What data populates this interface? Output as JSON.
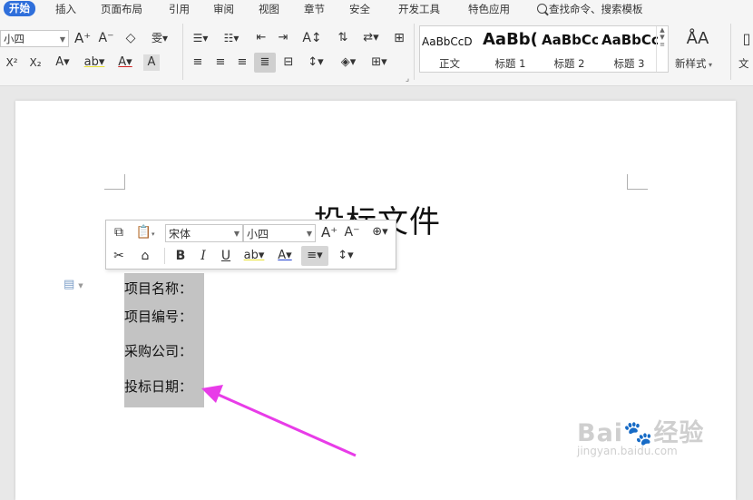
{
  "tabs": [
    "开始",
    "插入",
    "页面布局",
    "引用",
    "审阅",
    "视图",
    "章节",
    "安全",
    "开发工具",
    "特色应用"
  ],
  "search_tab": "查找命令、搜索模板",
  "ribbon": {
    "font_size": "小四",
    "styles": [
      {
        "sample": "AaBbCcD",
        "name": "正文"
      },
      {
        "sample": "AaBb(",
        "name": "标题 1"
      },
      {
        "sample": "AaBbCc",
        "name": "标题 2"
      },
      {
        "sample": "AaBbCc",
        "name": "标题 3"
      }
    ],
    "new_style": "新样式",
    "right_cut_label": "文"
  },
  "mini_toolbar": {
    "font": "宋体",
    "size": "小四"
  },
  "document": {
    "title": "投标文件",
    "fields": [
      "项目名称：",
      "项目编号：",
      "采购公司：",
      "投标日期："
    ]
  },
  "watermark": {
    "brand": "Bai",
    "brand_cn": "经验",
    "url": "jingyan.baidu.com"
  },
  "colors": {
    "accent": "#2f6fdb",
    "highlight": "#c3c3c3",
    "arrow": "#e83ce8"
  }
}
